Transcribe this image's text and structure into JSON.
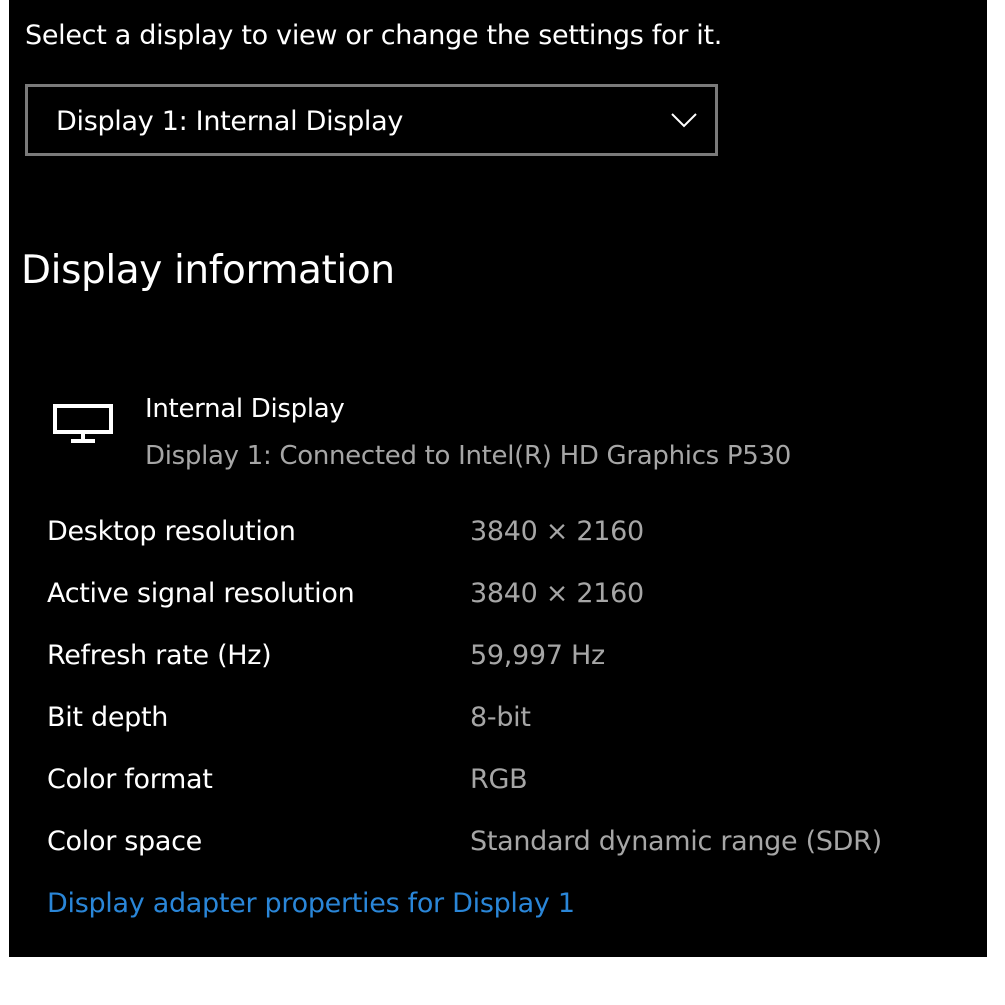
{
  "prompt": "Select a display to view or change the settings for it.",
  "display_select": {
    "selected": "Display 1: Internal Display",
    "icon": "chevron-down-icon"
  },
  "section_title": "Display information",
  "display": {
    "icon": "monitor-icon",
    "name": "Internal Display",
    "connection": "Display 1: Connected to Intel(R) HD Graphics P530"
  },
  "info_rows": [
    {
      "label": "Desktop resolution",
      "value": "3840 × 2160"
    },
    {
      "label": "Active signal resolution",
      "value": "3840 × 2160"
    },
    {
      "label": "Refresh rate (Hz)",
      "value": "59,997 Hz"
    },
    {
      "label": "Bit depth",
      "value": "8-bit"
    },
    {
      "label": "Color format",
      "value": "RGB"
    },
    {
      "label": "Color space",
      "value": "Standard dynamic range (SDR)"
    }
  ],
  "adapter_link": "Display adapter properties for Display 1",
  "colors": {
    "background": "#000000",
    "text_primary": "#ffffff",
    "text_secondary": "#a6a6a6",
    "link": "#2a86d8",
    "dropdown_border": "#7a7a7a"
  }
}
